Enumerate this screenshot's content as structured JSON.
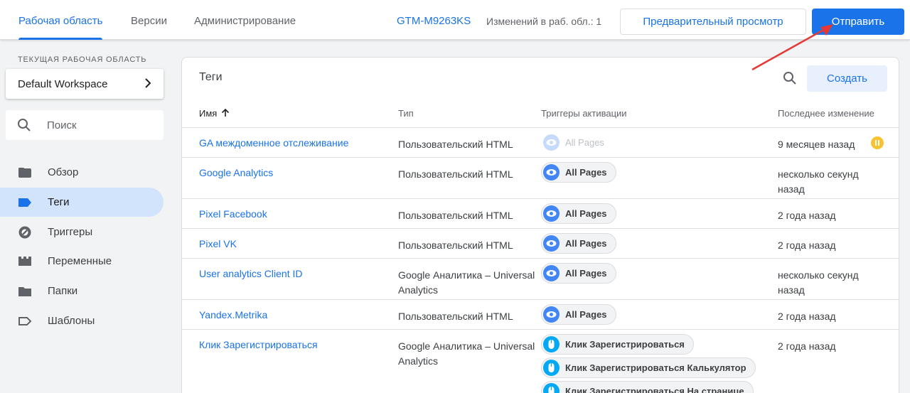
{
  "header": {
    "tabs": [
      {
        "label": "Рабочая область",
        "active": true
      },
      {
        "label": "Версии",
        "active": false
      },
      {
        "label": "Администрирование",
        "active": false
      }
    ],
    "container_id": "GTM-M9263KS",
    "changes_text": "Изменений в раб. обл.: 1",
    "preview_label": "Предварительный просмотр",
    "submit_label": "Отправить"
  },
  "sidebar": {
    "workspace_label": "ТЕКУЩАЯ РАБОЧАЯ ОБЛАСТЬ",
    "workspace_name": "Default Workspace",
    "search_placeholder": "Поиск",
    "items": [
      {
        "label": "Обзор",
        "icon": "folder-icon"
      },
      {
        "label": "Теги",
        "icon": "tag-icon",
        "active": true
      },
      {
        "label": "Триггеры",
        "icon": "trigger-icon"
      },
      {
        "label": "Переменные",
        "icon": "variables-icon"
      },
      {
        "label": "Папки",
        "icon": "folder-icon"
      },
      {
        "label": "Шаблоны",
        "icon": "template-icon"
      }
    ]
  },
  "tags": {
    "title": "Теги",
    "create_label": "Создать",
    "columns": {
      "name": "Имя",
      "type": "Тип",
      "triggers": "Триггеры активации",
      "modified": "Последнее изменение"
    },
    "rows": [
      {
        "name": "GA междоменное отслеживание",
        "type": "Пользовательский HTML",
        "triggers": [
          "All Pages"
        ],
        "modified": "9 месяцев назад",
        "paused": true
      },
      {
        "name": "Google Analytics",
        "type": "Пользовательский HTML",
        "triggers": [
          "All Pages"
        ],
        "modified": "несколько секунд назад"
      },
      {
        "name": "Pixel Facebook",
        "type": "Пользовательский HTML",
        "triggers": [
          "All Pages"
        ],
        "modified": "2 года назад"
      },
      {
        "name": "Pixel VK",
        "type": "Пользовательский HTML",
        "triggers": [
          "All Pages"
        ],
        "modified": "2 года назад"
      },
      {
        "name": "User analytics Client ID",
        "type": "Google Аналитика – Universal Analytics",
        "triggers": [
          "All Pages"
        ],
        "modified": "несколько секунд назад"
      },
      {
        "name": "Yandex.Metrika",
        "type": "Пользовательский HTML",
        "triggers": [
          "All Pages"
        ],
        "modified": "2 года назад"
      },
      {
        "name": "Клик Зарегистрироваться",
        "type": "Google Аналитика – Universal Analytics",
        "triggers": [
          "Клик Зарегистрироваться",
          "Клик Зарегистрироваться Калькулятор",
          "Клик Зарегистрироваться На странице"
        ],
        "modified": "2 года назад"
      }
    ]
  },
  "colors": {
    "accent": "#1a73e8",
    "active_nav": "#d2e3fc",
    "paused": "#f9c231",
    "annotation": "#e53935"
  }
}
